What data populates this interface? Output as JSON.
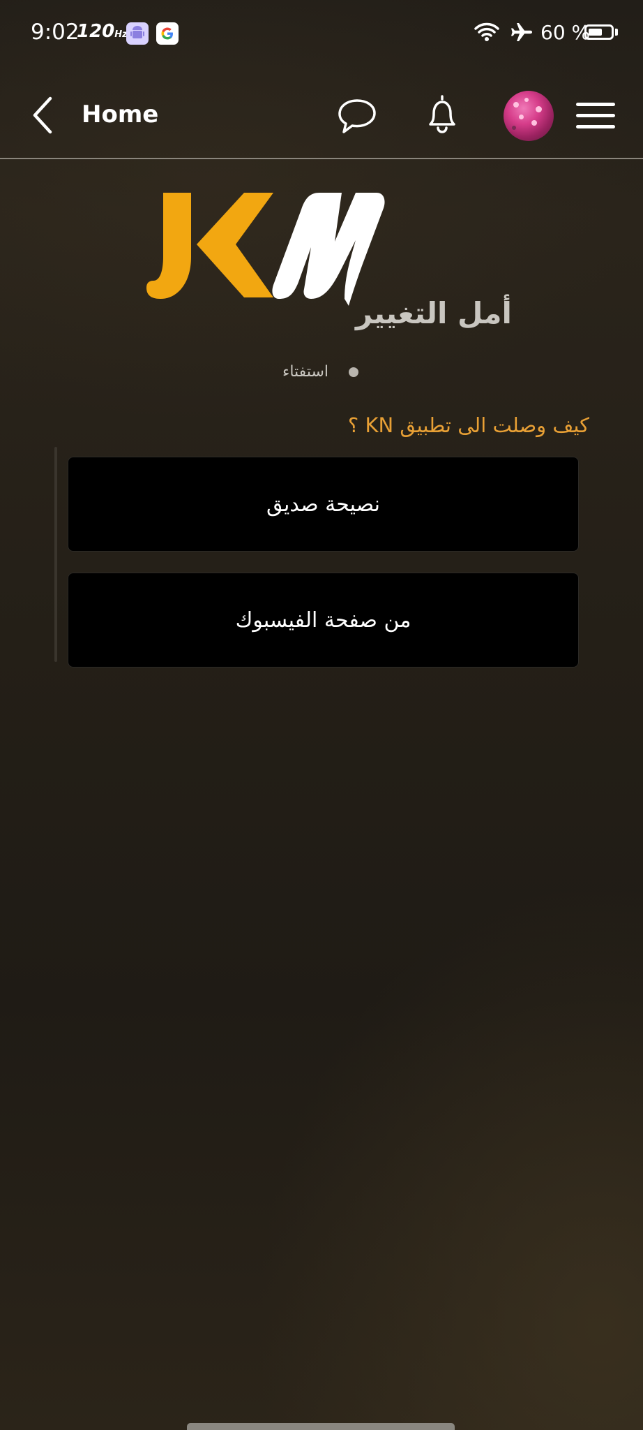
{
  "status_bar": {
    "time": "9:02",
    "refresh_rate": "120",
    "refresh_unit": "Hz",
    "battery": "60 %",
    "icons": [
      "android-icon",
      "google-icon",
      "wifi-icon",
      "airplane-mode-icon",
      "battery-icon"
    ]
  },
  "header": {
    "title": "Home",
    "icons": [
      "back-chevron-icon",
      "chat-bubble-icon",
      "bell-icon",
      "avatar",
      "hamburger-menu-icon"
    ]
  },
  "logo": {
    "tagline": "أمل التغيير",
    "colors": {
      "k": "#f2a711",
      "n": "#ffffff"
    }
  },
  "poll": {
    "type_label": "استفتاء",
    "question": "كيف وصلت الى تطبيق KN ؟",
    "options": [
      {
        "label": "نصيحة صديق"
      },
      {
        "label": "من صفحة الفيسبوك"
      }
    ]
  },
  "theme": {
    "accent": "#e8a035",
    "card_bg": "#000000",
    "text": "#ffffff"
  }
}
